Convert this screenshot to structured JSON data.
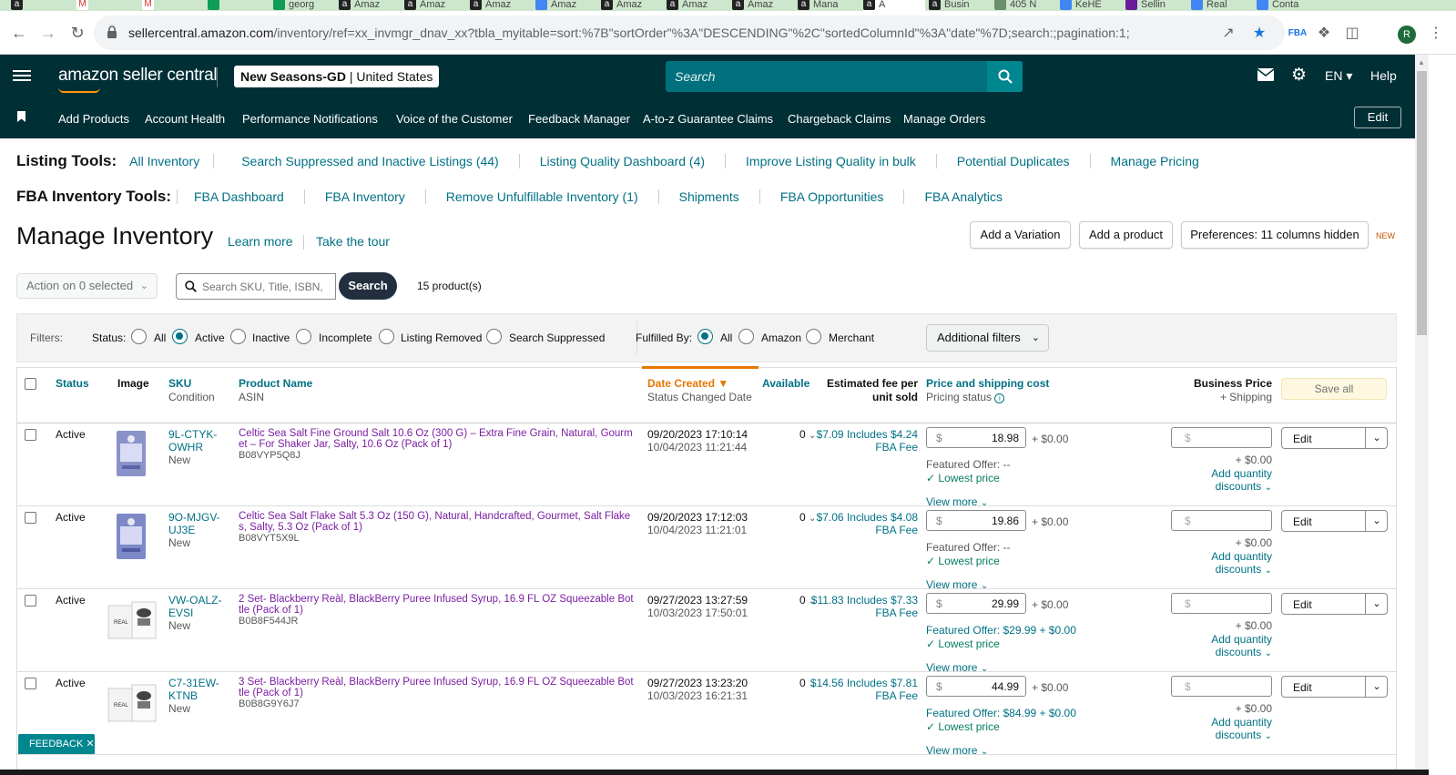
{
  "browser": {
    "tabs": [
      {
        "label": "",
        "icon": "amazon-favicon"
      },
      {
        "label": "",
        "icon": "gmail-favicon"
      },
      {
        "label": "",
        "icon": "gmail-favicon"
      },
      {
        "label": "",
        "icon": "sheets-favicon"
      },
      {
        "label": "georg",
        "icon": "sheets-favicon"
      },
      {
        "label": "Amaz",
        "icon": "amazon-favicon"
      },
      {
        "label": "Amaz",
        "icon": "amazon-favicon"
      },
      {
        "label": "Amaz",
        "icon": "amazon-favicon"
      },
      {
        "label": "Amaz",
        "icon": "generic-favicon"
      },
      {
        "label": "Amaz",
        "icon": "amazon-favicon"
      },
      {
        "label": "Amaz",
        "icon": "amazon-favicon"
      },
      {
        "label": "Amaz",
        "icon": "amazon-favicon"
      },
      {
        "label": "Mana",
        "icon": "amazon-favicon"
      },
      {
        "label": "A",
        "icon": "amazon-favicon"
      },
      {
        "label": "Busin",
        "icon": "amazon-favicon"
      },
      {
        "label": "405 N",
        "icon": "globe-favicon"
      },
      {
        "label": "KeHE",
        "icon": "generic-favicon"
      },
      {
        "label": "Sellin",
        "icon": "sellin-favicon"
      },
      {
        "label": "Real",
        "icon": "generic-favicon"
      },
      {
        "label": "Conta",
        "icon": "generic-favicon"
      }
    ],
    "url_host": "sellercentral.amazon.com",
    "url_path": "/inventory/ref=xx_invmgr_dnav_xx?tbla_myitable=sort:%7B\"sortOrder\"%3A\"DESCENDING\"%2C\"sortedColumnId\"%3A\"date\"%7D;search:;pagination:1;",
    "profile_initial": "R"
  },
  "header": {
    "logo": "amazon seller central",
    "store_name": "New Seasons-GD",
    "store_region": "United States",
    "search_placeholder": "Search",
    "language": "EN",
    "help": "Help"
  },
  "nav": {
    "items": [
      "Add Products",
      "Account Health",
      "Performance Notifications",
      "Voice of the Customer",
      "Feedback Manager",
      "A-to-z Guarantee Claims",
      "Chargeback Claims",
      "Manage Orders"
    ],
    "edit": "Edit"
  },
  "listing_tools": {
    "label": "Listing Tools:",
    "links": [
      "All Inventory",
      "Search Suppressed and Inactive Listings (44)",
      "Listing Quality Dashboard (4)",
      "Improve Listing Quality in bulk",
      "Potential Duplicates",
      "Manage Pricing"
    ]
  },
  "fba_tools": {
    "label": "FBA Inventory Tools:",
    "links": [
      "FBA Dashboard",
      "FBA Inventory",
      "Remove Unfulfillable Inventory (1)",
      "Shipments",
      "FBA Opportunities",
      "FBA Analytics"
    ]
  },
  "page": {
    "title": "Manage Inventory",
    "learn_more": "Learn more",
    "take_tour": "Take the tour",
    "add_variation": "Add a Variation",
    "add_product": "Add a product",
    "preferences": "Preferences: 11 columns hidden",
    "new_badge": "NEW",
    "action_select": "Action on 0 selected",
    "search_placeholder": "Search SKU, Title, ISBN,",
    "search_button": "Search",
    "product_count": "15 product(s)"
  },
  "filters": {
    "label": "Filters:",
    "status_label": "Status:",
    "status_options": [
      "All",
      "Active",
      "Inactive",
      "Incomplete",
      "Listing Removed",
      "Search Suppressed"
    ],
    "status_selected": "Active",
    "fulfilled_label": "Fulfilled By:",
    "fulfilled_options": [
      "All",
      "Amazon",
      "Merchant"
    ],
    "fulfilled_selected": "All",
    "additional": "Additional filters"
  },
  "table": {
    "headers": {
      "status": "Status",
      "image": "Image",
      "sku": "SKU",
      "condition": "Condition",
      "product_name": "Product Name",
      "asin": "ASIN",
      "date_created": "Date Created",
      "status_changed": "Status Changed Date",
      "available": "Available",
      "fee_line1": "Estimated fee per",
      "fee_line2": "unit sold",
      "price": "Price and shipping cost",
      "pricing_status": "Pricing status",
      "business_price": "Business Price",
      "plus_shipping": "+ Shipping",
      "save_all": "Save all"
    },
    "rows": [
      {
        "status": "Active",
        "sku": "9L-CTYK-OWHR",
        "condition": "New",
        "name": "Celtic Sea Salt Fine Ground Salt 10.6 Oz (300 G) – Extra Fine Grain, Natural, Gourmet – For Shaker Jar, Salty, 10.6 Oz (Pack of 1)",
        "asin": "B08VYP5Q8J",
        "date_created": "09/20/2023 17:10:14",
        "status_changed": "10/04/2023 11:21:44",
        "available": "0",
        "fee": "$7.09 Includes $4.24 FBA Fee",
        "currency": "$",
        "price": "18.98",
        "shipping": "+ $0.00",
        "featured": "Featured Offer: --",
        "lowest": "Lowest price",
        "view_more": "View more",
        "biz_currency": "$",
        "biz_shipping": "+ $0.00",
        "qty_discounts": "Add quantity discounts",
        "edit": "Edit",
        "image": "celtic-salt-fine"
      },
      {
        "status": "Active",
        "sku": "9O-MJGV-UJ3E",
        "condition": "New",
        "name": "Celtic Sea Salt Flake Salt 5.3 Oz (150 G), Natural, Handcrafted, Gourmet, Salt Flakes, Salty, 5.3 Oz (Pack of 1)",
        "asin": "B08VYT5X9L",
        "date_created": "09/20/2023 17:12:03",
        "status_changed": "10/04/2023 11:21:01",
        "available": "0",
        "fee": "$7.06 Includes $4.08 FBA Fee",
        "currency": "$",
        "price": "19.86",
        "shipping": "+ $0.00",
        "featured": "Featured Offer: --",
        "lowest": "Lowest price",
        "view_more": "View more",
        "biz_currency": "$",
        "biz_shipping": "+ $0.00",
        "qty_discounts": "Add quantity discounts",
        "edit": "Edit",
        "image": "celtic-salt-flake"
      },
      {
        "status": "Active",
        "sku": "VW-OALZ-EVSI",
        "condition": "New",
        "name": "2 Set- Blackberry Reàl, BlackBerry Puree Infused Syrup, 16.9 FL OZ Squeezable Bottle (Pack of 1)",
        "asin": "B0B8F544JR",
        "date_created": "09/27/2023 13:27:59",
        "status_changed": "10/03/2023 17:50:01",
        "available": "0",
        "fee": "$11.83 Includes $7.33 FBA Fee",
        "currency": "$",
        "price": "29.99",
        "shipping": "+ $0.00",
        "featured": "Featured Offer: $29.99 + $0.00",
        "lowest": "Lowest price",
        "view_more": "View more",
        "biz_currency": "$",
        "biz_shipping": "+ $0.00",
        "qty_discounts": "Add quantity discounts",
        "edit": "Edit",
        "image": "real-syrup-box"
      },
      {
        "status": "Active",
        "sku": "C7-31EW-KTNB",
        "condition": "New",
        "name": "3 Set- Blackberry Reàl, BlackBerry Puree Infused Syrup, 16.9 FL OZ Squeezable Bottle (Pack of 1)",
        "asin": "B0B8G9Y6J7",
        "date_created": "09/27/2023 13:23:20",
        "status_changed": "10/03/2023 16:21:31",
        "available": "0",
        "fee": "$14.56 Includes $7.81 FBA Fee",
        "currency": "$",
        "price": "44.99",
        "shipping": "+ $0.00",
        "featured": "Featured Offer: $84.99 + $0.00",
        "lowest": "Lowest price",
        "view_more": "View more",
        "biz_currency": "$",
        "biz_shipping": "+ $0.00",
        "qty_discounts": "Add quantity discounts",
        "edit": "Edit",
        "image": "real-syrup-box"
      }
    ]
  },
  "feedback": "FEEDBACK",
  "colors": {
    "header_bg": "#002f36",
    "link": "#007185",
    "product_link": "#7b1fa2",
    "sort_accent": "#e77600",
    "success": "#067d62"
  }
}
